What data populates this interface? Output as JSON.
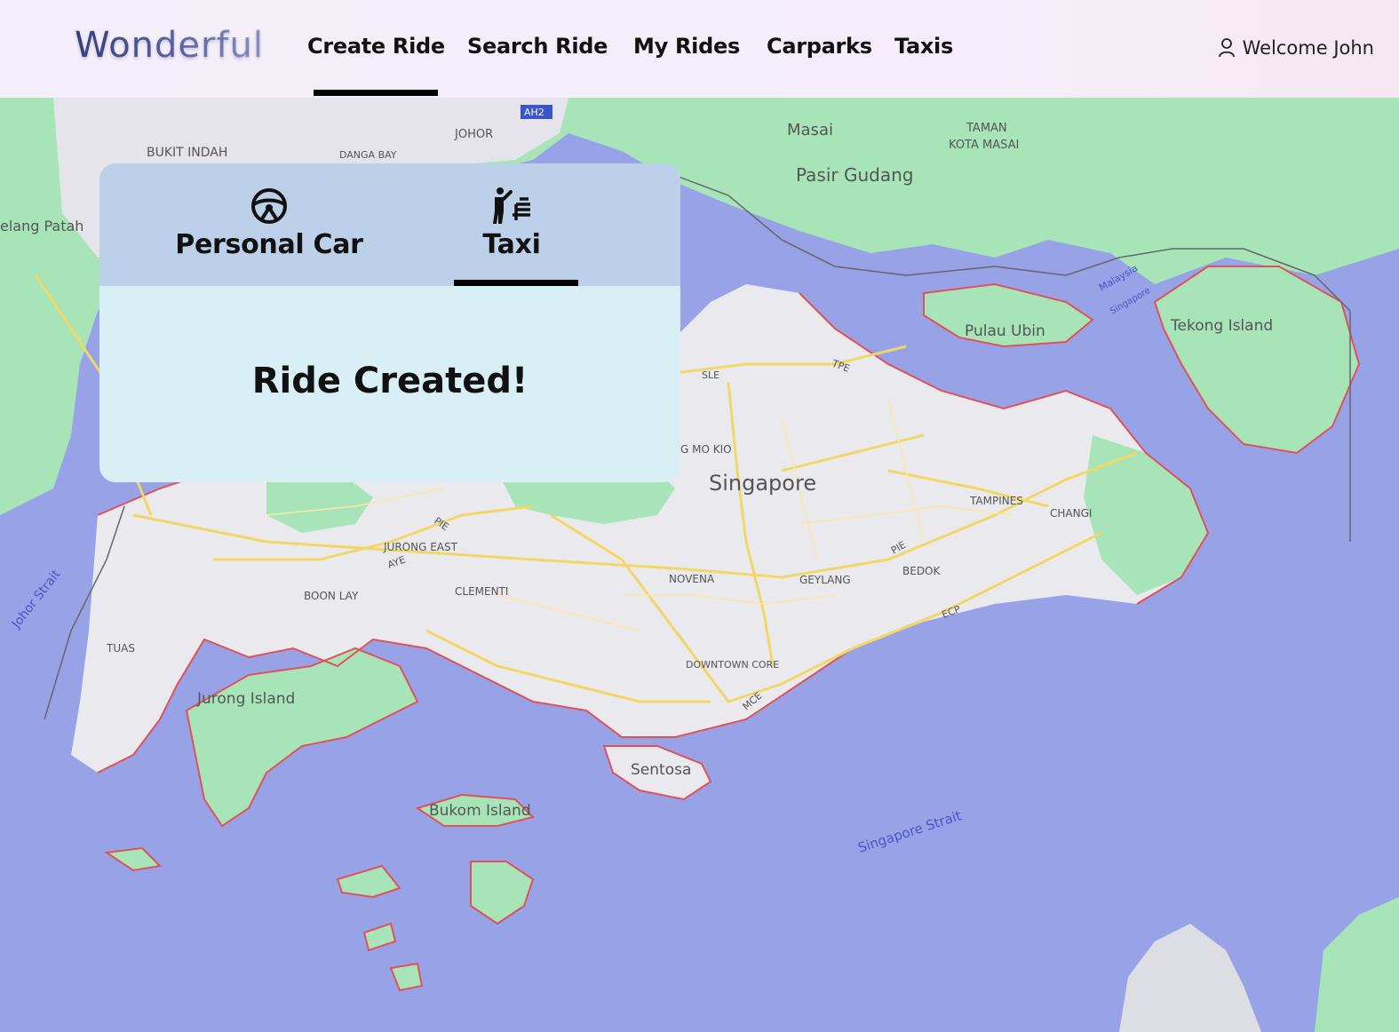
{
  "app": {
    "logo": "Wonderful"
  },
  "nav": {
    "items": [
      {
        "label": "Create Ride",
        "active": true
      },
      {
        "label": "Search Ride",
        "active": false
      },
      {
        "label": "My Rides",
        "active": false
      },
      {
        "label": "Carparks",
        "active": false
      },
      {
        "label": "Taxis",
        "active": false
      }
    ],
    "welcome": "Welcome John"
  },
  "panel": {
    "tabs": [
      {
        "label": "Personal Car",
        "icon": "steering-wheel-icon",
        "active": false
      },
      {
        "label": "Taxi",
        "icon": "hail-taxi-icon",
        "active": true
      }
    ],
    "message": "Ride Created!"
  },
  "map": {
    "labels": {
      "bukit_indah": "BUKIT INDAH",
      "johor": "JOHOR",
      "danga_bay": "DANGA BAY",
      "masai": "Masai",
      "taman": "TAMAN",
      "kota_masai": "KOTA MASAI",
      "pasir_gudang": "Pasir Gudang",
      "gelang_patah": "elang Patah",
      "pulau_ubin": "Pulau Ubin",
      "tekong_island": "Tekong Island",
      "singapore": "Singapore",
      "tampines": "TAMPINES",
      "changi": "CHANGI",
      "bedok": "BEDOK",
      "geylang": "GEYLANG",
      "novena": "NOVENA",
      "jurong_east": "JURONG EAST",
      "clementi": "CLEMENTI",
      "boon_lay": "BOON LAY",
      "tuas": "TUAS",
      "jurong_island": "Jurong Island",
      "downtown_core": "DOWNTOWN CORE",
      "sentosa": "Sentosa",
      "bukom_island": "Bukom Island",
      "singapore_strait": "Singapore Strait",
      "johor_strait": "Johor Strait",
      "ang_mo_kio": "G MO KIO",
      "malaysia": "Malaysia",
      "singapore_small": "Singapore",
      "pie": "PIE",
      "aye": "AYE",
      "ecp": "ECP",
      "mce": "MCE",
      "sle": "SLE",
      "tpe": "TPE",
      "ah2": "AH2"
    },
    "colors": {
      "sea": "#97a3e6",
      "land": "#e9e9ee",
      "green": "#a7e5b8",
      "road": "#f3d766",
      "border": "#e0525a"
    }
  }
}
